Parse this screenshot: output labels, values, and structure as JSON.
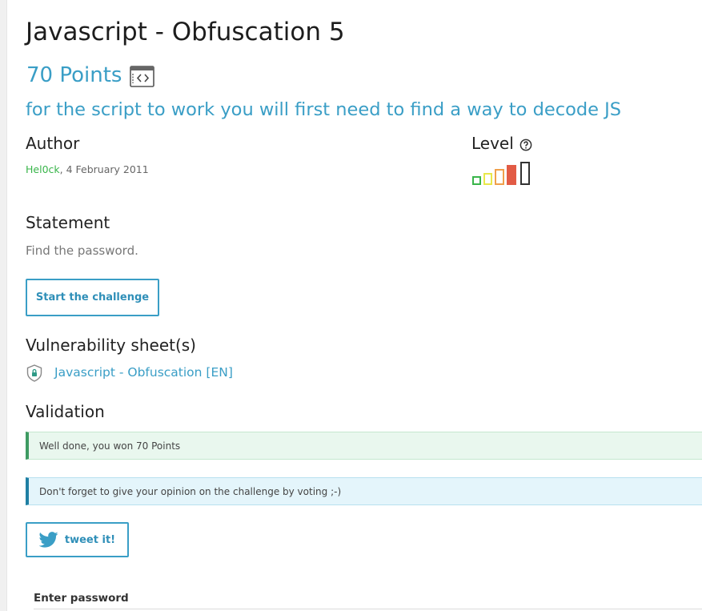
{
  "challenge": {
    "title": "Javascript - Obfuscation 5",
    "points": "70 Points",
    "subtitle": "for the script to work you will first need to find a way to decode JS"
  },
  "author": {
    "label": "Author",
    "name": "Hel0ck",
    "date": ",  4 February 2011"
  },
  "level": {
    "label": "Level",
    "help_icon": "question-circle-icon",
    "bars_total": 5,
    "bars_active": 4,
    "colors": [
      "#39b54a",
      "#e8e84a",
      "#f0a04b",
      "#e25b45",
      "#333333"
    ]
  },
  "statement": {
    "label": "Statement",
    "text": "Find the password."
  },
  "start_button": "Start the challenge",
  "vulnerability": {
    "label": "Vulnerability sheet(s)",
    "icon": "shield-lock-icon",
    "link": "Javascript - Obfuscation [EN]"
  },
  "validation": {
    "label": "Validation",
    "success": "Well done, you won 70 Points",
    "info": "Don't forget to give your opinion on the challenge by voting ;-)"
  },
  "tweet": {
    "label": "tweet it!",
    "icon": "twitter-icon"
  },
  "password": {
    "label": "Enter password",
    "value": ""
  },
  "colors": {
    "accent": "#3a9ec6",
    "author": "#39b54a",
    "success_border": "#3e9b62",
    "info_border": "#1f7fa3"
  }
}
